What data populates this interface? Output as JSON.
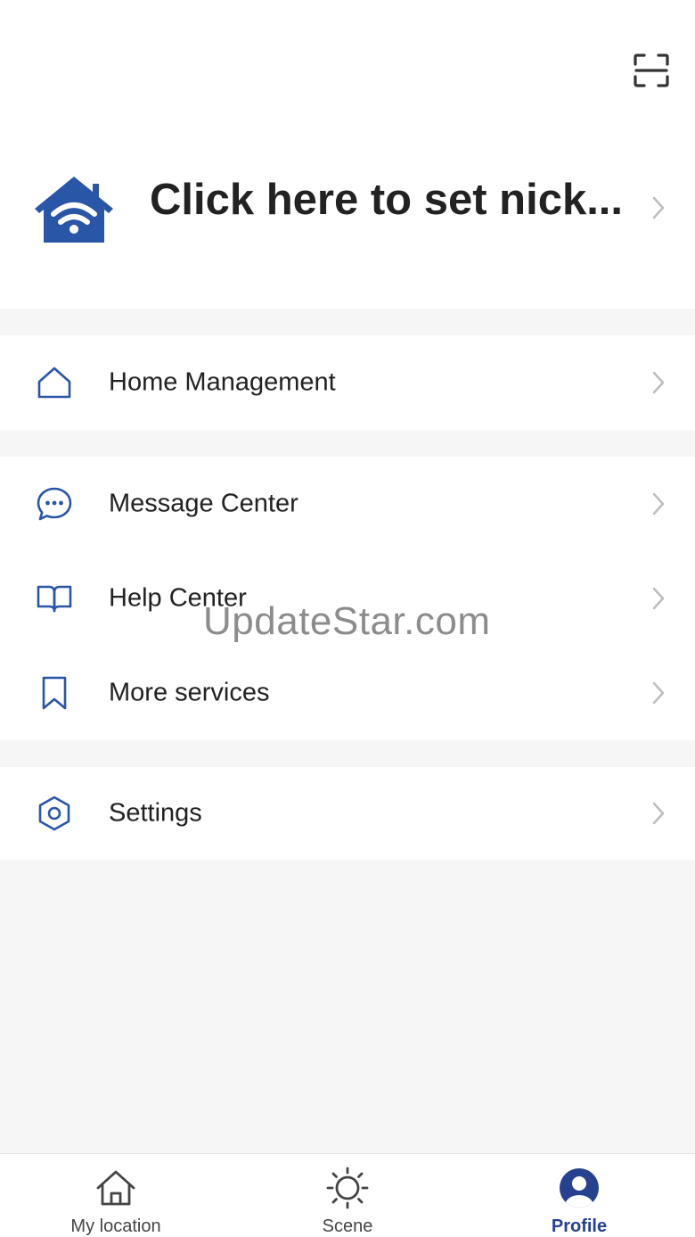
{
  "header": {
    "nickname": "Click here to set nick...",
    "avatar_icon": "home-wifi-icon",
    "scan_icon": "scan-icon"
  },
  "menu": {
    "home_management": {
      "label": "Home Management",
      "icon": "home-icon"
    },
    "message_center": {
      "label": "Message Center",
      "icon": "chat-bubble-icon"
    },
    "help_center": {
      "label": "Help Center",
      "icon": "book-icon"
    },
    "more_services": {
      "label": "More services",
      "icon": "bookmark-icon"
    },
    "settings": {
      "label": "Settings",
      "icon": "hexagon-gear-icon"
    }
  },
  "watermark": "UpdateStar.com",
  "tabs": [
    {
      "label": "My location",
      "icon": "house-icon",
      "active": false
    },
    {
      "label": "Scene",
      "icon": "sun-icon",
      "active": false
    },
    {
      "label": "Profile",
      "icon": "user-circle-icon",
      "active": true
    }
  ],
  "colors": {
    "accent": "#26418f",
    "icon_blue": "#2a56a8",
    "background": "#f6f6f6",
    "chevron": "#bdbdbd"
  }
}
